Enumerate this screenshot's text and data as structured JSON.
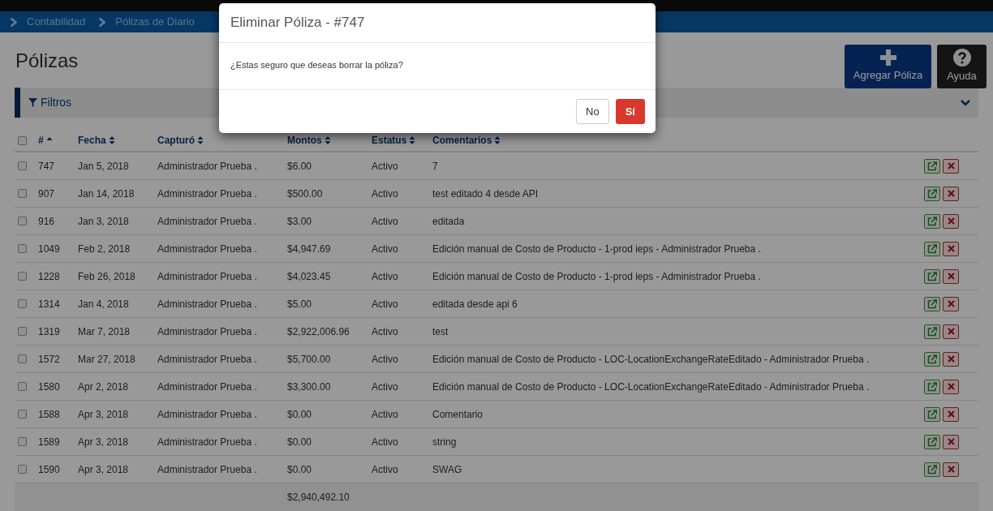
{
  "breadcrumb": [
    "Contabilidad",
    "Pólizas de Diario"
  ],
  "page_title": "Pólizas",
  "toolbar": {
    "add_button": "Agregar Póliza",
    "help_button": "Ayuda"
  },
  "filters": {
    "label": "Filtros",
    "expanded": false
  },
  "table": {
    "select_all_checked": false,
    "columns": [
      {
        "label": "#",
        "sorted": true
      },
      {
        "label": "Fecha",
        "sorted": false
      },
      {
        "label": "Capturó",
        "sorted": false
      },
      {
        "label": "Montos",
        "sorted": false
      },
      {
        "label": "Estatus",
        "sorted": false
      },
      {
        "label": "Comentarios",
        "sorted": false
      }
    ],
    "rows": [
      {
        "checked": false,
        "cells": [
          "747",
          "Jan 5, 2018",
          "Administrador Prueba .",
          "$6.00",
          "Activo",
          "7"
        ]
      },
      {
        "checked": false,
        "cells": [
          "907",
          "Jan 14, 2018",
          "Administrador Prueba .",
          "$500.00",
          "Activo",
          "test editado 4 desde API"
        ]
      },
      {
        "checked": false,
        "cells": [
          "916",
          "Jan 3, 2018",
          "Administrador Prueba .",
          "$3.00",
          "Activo",
          "editada"
        ]
      },
      {
        "checked": false,
        "cells": [
          "1049",
          "Feb 2, 2018",
          "Administrador Prueba .",
          "$4,947.69",
          "Activo",
          "Edición manual de Costo de Producto - 1-prod ieps - Administrador Prueba ."
        ]
      },
      {
        "checked": false,
        "cells": [
          "1228",
          "Feb 26, 2018",
          "Administrador Prueba .",
          "$4,023.45",
          "Activo",
          "Edición manual de Costo de Producto - 1-prod ieps - Administrador Prueba ."
        ]
      },
      {
        "checked": false,
        "cells": [
          "1314",
          "Jan 4, 2018",
          "Administrador Prueba .",
          "$5.00",
          "Activo",
          "editada desde api 6"
        ]
      },
      {
        "checked": false,
        "cells": [
          "1319",
          "Mar 7, 2018",
          "Administrador Prueba .",
          "$2,922,006.96",
          "Activo",
          "test"
        ]
      },
      {
        "checked": false,
        "cells": [
          "1572",
          "Mar 27, 2018",
          "Administrador Prueba .",
          "$5,700.00",
          "Activo",
          "Edición manual de Costo de Producto - LOC-LocationExchangeRateEditado - Administrador Prueba ."
        ]
      },
      {
        "checked": false,
        "cells": [
          "1580",
          "Apr 2, 2018",
          "Administrador Prueba .",
          "$3,300.00",
          "Activo",
          "Edición manual de Costo de Producto - LOC-LocationExchangeRateEditado - Administrador Prueba ."
        ]
      },
      {
        "checked": false,
        "cells": [
          "1588",
          "Apr 3, 2018",
          "Administrador Prueba .",
          "$0.00",
          "Activo",
          "Comentario"
        ]
      },
      {
        "checked": false,
        "cells": [
          "1589",
          "Apr 3, 2018",
          "Administrador Prueba .",
          "$0.00",
          "Activo",
          "string"
        ]
      },
      {
        "checked": false,
        "cells": [
          "1590",
          "Apr 3, 2018",
          "Administrador Prueba .",
          "$0.00",
          "Activo",
          "SWAG"
        ]
      }
    ],
    "total": "$2,940,492.10"
  },
  "dialog": {
    "title": "Eliminar Póliza - #747",
    "message": "¿Estas seguro que deseas borrar la póliza?",
    "buttons": [
      {
        "label": "No",
        "kind": "cancel"
      },
      {
        "label": "Sí",
        "kind": "confirm"
      }
    ]
  }
}
